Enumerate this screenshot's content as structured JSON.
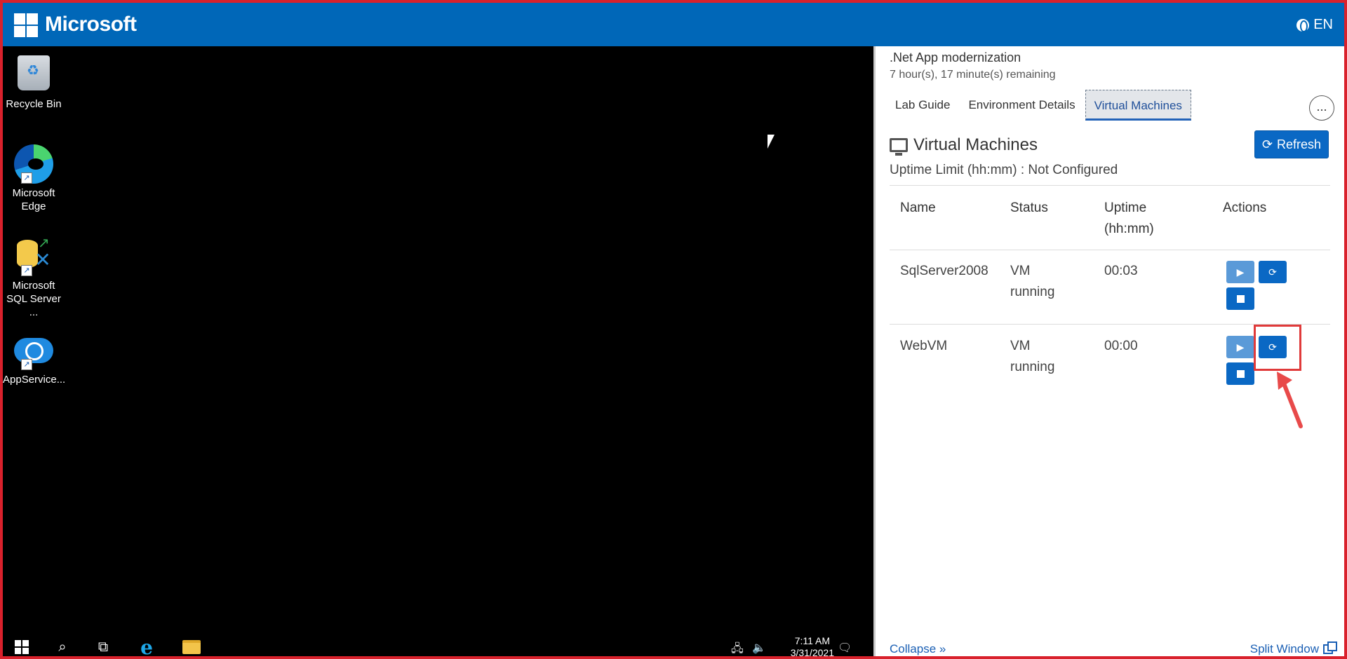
{
  "topbar": {
    "brand": "Microsoft",
    "language": "EN"
  },
  "desktop": {
    "icons": [
      {
        "label": "Recycle Bin",
        "icon": "recycle-bin-icon"
      },
      {
        "label": "Microsoft Edge",
        "icon": "edge-icon"
      },
      {
        "label": "Microsoft SQL Server ...",
        "icon": "sql-server-icon"
      },
      {
        "label": "AppService...",
        "icon": "app-service-icon"
      }
    ]
  },
  "taskbar": {
    "time": "7:11 AM",
    "date": "3/31/2021"
  },
  "panel": {
    "lab_title": ".Net App modernization",
    "remaining": "7 hour(s), 17 minute(s) remaining",
    "tabs": [
      {
        "label": "Lab Guide"
      },
      {
        "label": "Environment Details"
      },
      {
        "label": "Virtual Machines"
      }
    ],
    "more_label": "...",
    "vm_title": "Virtual Machines",
    "refresh_label": "Refresh",
    "uptime_limit": "Uptime Limit (hh:mm) : Not Configured",
    "table": {
      "headers": {
        "name": "Name",
        "status": "Status",
        "uptime": "Uptime (hh:mm)",
        "actions": "Actions"
      },
      "rows": [
        {
          "name": "SqlServer2008",
          "status": "VM running",
          "uptime": "00:03"
        },
        {
          "name": "WebVM",
          "status": "VM running",
          "uptime": "00:00"
        }
      ]
    },
    "collapse_label": "Collapse »",
    "split_label": "Split Window"
  },
  "colors": {
    "brand_blue": "#0067b8",
    "button_blue": "#0a68c4",
    "highlight_red": "#e03a3a"
  }
}
